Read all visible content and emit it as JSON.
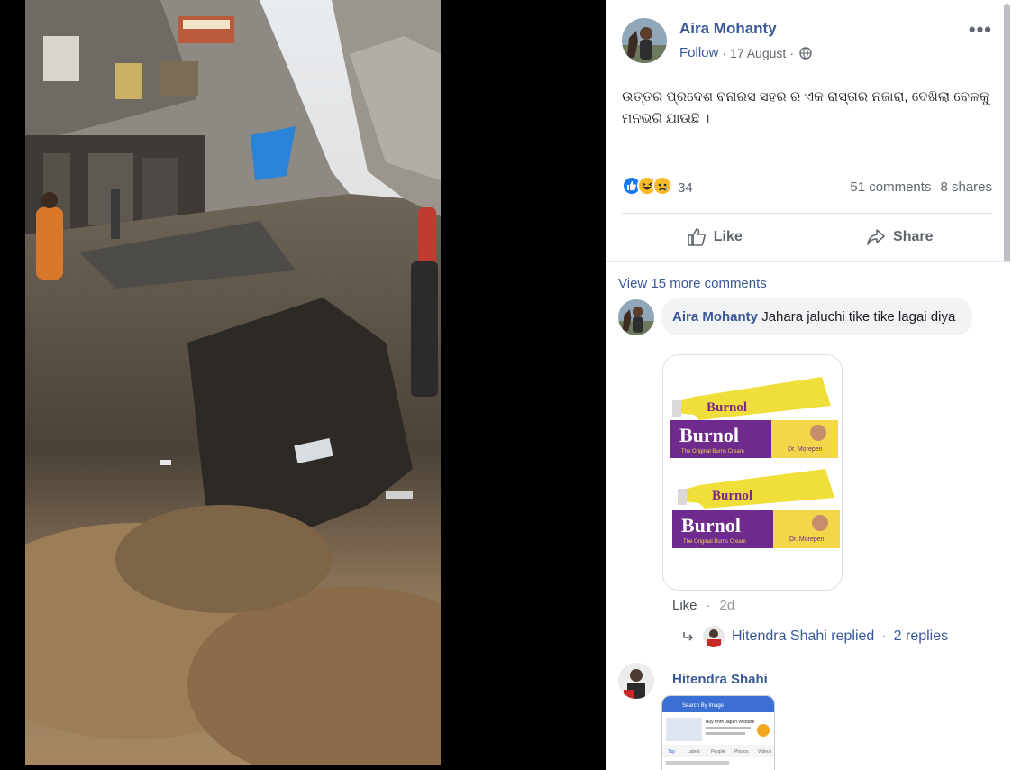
{
  "post": {
    "author": "Aira Mohanty",
    "follow_label": "Follow",
    "date": "17 August",
    "separator": "·",
    "more_label": "•••",
    "text": "ଉତ୍ତର ପ୍ରଦେଶ ବନାରସ ସହର ର ଏକ ରାସ୍ତାର ନଜାରା, ଦେଖିଲା ବେଳକୁ ମନଭରି ଯାଉଛି ।",
    "reaction_count": "34",
    "comments_count": "51 comments",
    "shares_count": "8 shares",
    "like_label": "Like",
    "share_label": "Share"
  },
  "comments": {
    "view_more": "View 15 more comments",
    "first": {
      "author": "Aira Mohanty",
      "text": "Jahara jaluchi tike tike lagai diya",
      "like_label": "Like",
      "separator": "·",
      "age": "2d",
      "replies_text": "Hitendra Shahi replied",
      "replies_count": "2 replies"
    },
    "second": {
      "author": "Hitendra Shahi"
    }
  },
  "attachment": {
    "brand": "Burnol",
    "tagline": "The Original Burns Cream",
    "maker": "Dr. Morepen"
  },
  "thumb": {
    "bar_title": "Search By Image",
    "headline": "Buy from Japan Website",
    "tabs": [
      "Top",
      "Latest",
      "People",
      "Photos",
      "Videos"
    ]
  },
  "colors": {
    "link": "#385898",
    "like_blue": "#1877f2",
    "emoji_yellow": "#f7b928"
  }
}
